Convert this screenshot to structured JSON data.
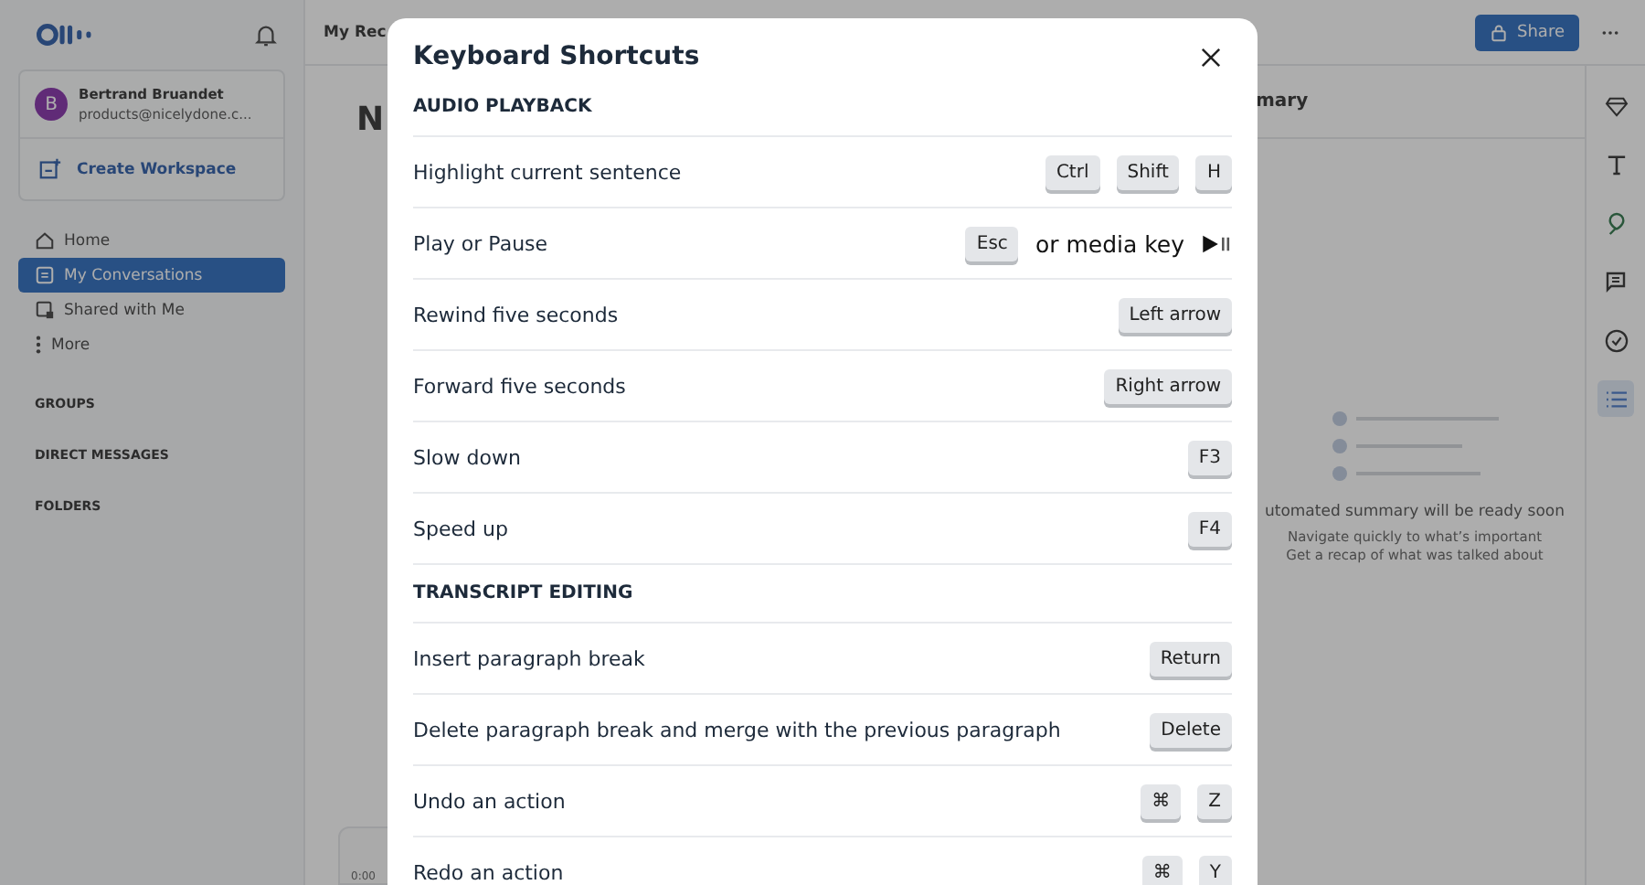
{
  "sidebar": {
    "user": {
      "initial": "B",
      "name": "Bertrand Bruandet",
      "email": "products@nicelydone.c..."
    },
    "create_workspace": "Create Workspace",
    "nav": [
      {
        "label": "Home",
        "selected": false
      },
      {
        "label": "My Conversations",
        "selected": true
      },
      {
        "label": "Shared with Me",
        "selected": false
      },
      {
        "label": "More",
        "selected": false
      }
    ],
    "sections": [
      "GROUPS",
      "DIRECT MESSAGES",
      "FOLDERS"
    ]
  },
  "topbar": {
    "breadcrumb": "My Rec",
    "share": "Share"
  },
  "main": {
    "title": "N",
    "player_time": "0:00"
  },
  "summary": {
    "title": "mary",
    "empty_title": "utomated summary will be ready soon",
    "hints": [
      "Navigate quickly to what’s important",
      "Get a recap of what was talked about"
    ]
  },
  "rail": [
    {
      "selected": false
    },
    {
      "selected": false
    },
    {
      "selected": false
    },
    {
      "selected": false
    },
    {
      "selected": false
    },
    {
      "selected": true
    }
  ],
  "modal": {
    "title": "Keyboard Shortcuts",
    "sections": [
      {
        "heading": "AUDIO PLAYBACK",
        "rows": [
          {
            "action": "Highlight current sentence",
            "keys": [
              {
                "kind": "key",
                "text": "Ctrl"
              },
              {
                "kind": "key",
                "text": "Shift"
              },
              {
                "kind": "key",
                "text": "H"
              }
            ]
          },
          {
            "action": "Play or Pause",
            "keys": [
              {
                "kind": "key",
                "text": "Esc"
              },
              {
                "kind": "text",
                "text": "or media key"
              },
              {
                "kind": "media"
              }
            ]
          },
          {
            "action": "Rewind five seconds",
            "keys": [
              {
                "kind": "key",
                "text": "Left arrow"
              }
            ]
          },
          {
            "action": "Forward five seconds",
            "keys": [
              {
                "kind": "key",
                "text": "Right arrow"
              }
            ]
          },
          {
            "action": "Slow down",
            "keys": [
              {
                "kind": "key",
                "text": "F3"
              }
            ]
          },
          {
            "action": "Speed up",
            "keys": [
              {
                "kind": "key",
                "text": "F4"
              }
            ]
          }
        ]
      },
      {
        "heading": "TRANSCRIPT EDITING",
        "rows": [
          {
            "action": "Insert paragraph break",
            "keys": [
              {
                "kind": "key",
                "text": "Return"
              }
            ]
          },
          {
            "action": "Delete paragraph break and merge with the previous paragraph",
            "keys": [
              {
                "kind": "key",
                "text": "Delete"
              }
            ]
          },
          {
            "action": "Undo an action",
            "keys": [
              {
                "kind": "key",
                "text": "⌘"
              },
              {
                "kind": "key",
                "text": "Z"
              }
            ]
          },
          {
            "action": "Redo an action",
            "keys": [
              {
                "kind": "key",
                "text": "⌘"
              },
              {
                "kind": "key",
                "text": "Y"
              }
            ]
          }
        ]
      }
    ]
  }
}
